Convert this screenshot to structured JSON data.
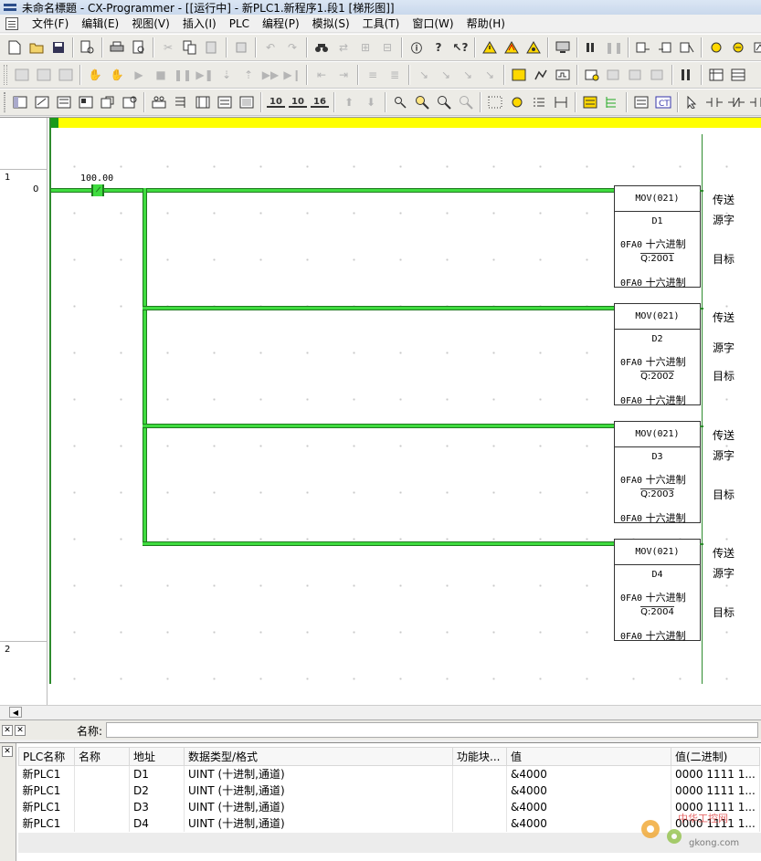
{
  "window": {
    "title": "未命名標題 - CX-Programmer - [[运行中] - 新PLC1.新程序1.段1 [梯形图]]"
  },
  "menu": {
    "items": [
      "文件(F)",
      "编辑(E)",
      "视图(V)",
      "插入(I)",
      "PLC",
      "编程(P)",
      "模拟(S)",
      "工具(T)",
      "窗口(W)",
      "帮助(H)"
    ]
  },
  "toolbar3": {
    "num1": "10",
    "num2": "10",
    "num3": "16"
  },
  "ladder": {
    "rungs": [
      {
        "number": "1",
        "step": "0"
      },
      {
        "number": "2",
        "step": ""
      }
    ],
    "contact_address": "100.00",
    "instructions": [
      {
        "mnemonic": "MOV(021)",
        "source": "D1",
        "source_format": "0FA0",
        "dest": "Q:2001",
        "dest_format": "0FA0",
        "format_label": "十六进制",
        "comment_op": "传送",
        "comment_source": "源字",
        "comment_dest": "目标"
      },
      {
        "mnemonic": "MOV(021)",
        "source": "D2",
        "source_format": "0FA0",
        "dest": "Q:2002",
        "dest_format": "0FA0",
        "format_label": "十六进制",
        "comment_op": "传送",
        "comment_source": "源字",
        "comment_dest": "目标"
      },
      {
        "mnemonic": "MOV(021)",
        "source": "D3",
        "source_format": "0FA0",
        "dest": "Q:2003",
        "dest_format": "0FA0",
        "format_label": "十六进制",
        "comment_op": "传送",
        "comment_source": "源字",
        "comment_dest": "目标"
      },
      {
        "mnemonic": "MOV(021)",
        "source": "D4",
        "source_format": "0FA0",
        "dest": "Q:2004",
        "dest_format": "0FA0",
        "format_label": "十六进制",
        "comment_op": "传送",
        "comment_source": "源字",
        "comment_dest": "目标"
      }
    ]
  },
  "watch": {
    "name_label": "名称:",
    "columns": [
      "PLC名称",
      "名称",
      "地址",
      "数据类型/格式",
      "功能块...",
      "值",
      "值(二进制)"
    ],
    "rows": [
      [
        "新PLC1",
        "",
        "D1",
        "UINT (十进制,通道)",
        "",
        "&4000",
        "0000 1111 1..."
      ],
      [
        "新PLC1",
        "",
        "D2",
        "UINT (十进制,通道)",
        "",
        "&4000",
        "0000 1111 1..."
      ],
      [
        "新PLC1",
        "",
        "D3",
        "UINT (十进制,通道)",
        "",
        "&4000",
        "0000 1111 1..."
      ],
      [
        "新PLC1",
        "",
        "D4",
        "UINT (十进制,通道)",
        "",
        "&4000",
        "0000 1111 1..."
      ]
    ]
  },
  "watermark": {
    "line1": "中华工控网",
    "line2": "gkong.com"
  }
}
